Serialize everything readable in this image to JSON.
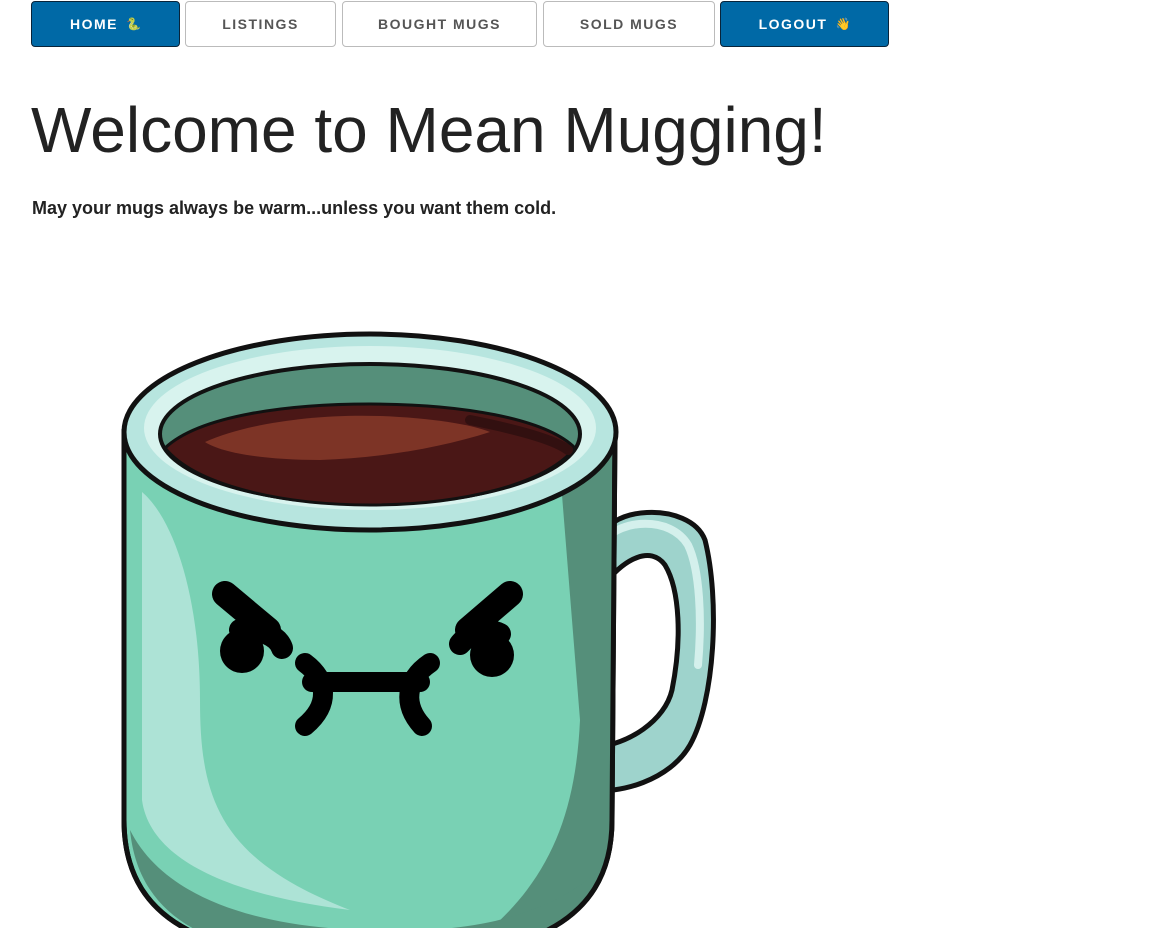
{
  "nav": {
    "home_label": "HOME",
    "home_emoji": "🐍",
    "listings_label": "LISTINGS",
    "bought_label": "BOUGHT MUGS",
    "sold_label": "SOLD MUGS",
    "logout_label": "LOGOUT",
    "logout_emoji": "👋"
  },
  "main": {
    "title": "Welcome to Mean Mugging!",
    "tagline": "May your mugs always be warm...unless you want them cold."
  },
  "colors": {
    "primary_button": "#0069a6",
    "mug_body": "#79d1b4",
    "mug_shadow": "#558f7a",
    "mug_rim": "#b7e5df",
    "coffee": "#4a1716"
  },
  "illustration": {
    "name": "angry-mug-illustration"
  }
}
